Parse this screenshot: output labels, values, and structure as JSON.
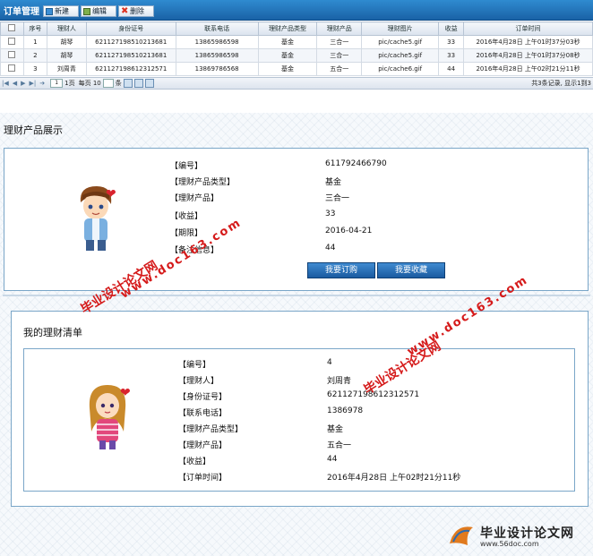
{
  "header": {
    "title": "订单管理",
    "toolbar": {
      "new_label": "新建",
      "edit_label": "编辑",
      "delete_label": "删除"
    }
  },
  "grid": {
    "columns": [
      "",
      "序号",
      "理财人",
      "身份证号",
      "联系电话",
      "理财产品类型",
      "理财产品",
      "理财图片",
      "收益",
      "订单时间"
    ],
    "rows": [
      {
        "no": "1",
        "person": "胡琴",
        "idcard": "621127198510213681",
        "phone": "13865986598",
        "type": "基金",
        "product": "三合一",
        "image": "pic/cache5.gif",
        "income": "33",
        "time": "2016年4月28日 上午01时37分03秒"
      },
      {
        "no": "2",
        "person": "胡琴",
        "idcard": "621127198510213681",
        "phone": "13865986598",
        "type": "基金",
        "product": "三合一",
        "image": "pic/cache5.gif",
        "income": "33",
        "time": "2016年4月28日 上午01时37分08秒"
      },
      {
        "no": "3",
        "person": "刘周青",
        "idcard": "621127198612312571",
        "phone": "13869786568",
        "type": "基金",
        "product": "五合一",
        "image": "pic/cache6.gif",
        "income": "44",
        "time": "2016年4月28日 上午02时21分11秒"
      }
    ]
  },
  "pager": {
    "page_value": "1",
    "page_suffix": "1页",
    "per_page_label": "每页 10",
    "per_page_unit": "条",
    "summary": "共3条记录, 显示1到3"
  },
  "product_display": {
    "title": "理财产品展示",
    "fields": [
      {
        "label": "【编号】",
        "value": "611792466790"
      },
      {
        "label": "【理财产品类型】",
        "value": "基金"
      },
      {
        "label": "【理财产品】",
        "value": "三合一"
      },
      {
        "label": "【收益】",
        "value": "33"
      },
      {
        "label": "【期限】",
        "value": "2016-04-21"
      },
      {
        "label": "【备注信息】",
        "value": "44"
      }
    ],
    "buy_button": "我要订购",
    "fav_button": "我要收藏"
  },
  "my_list": {
    "title": "我的理财清单",
    "fields": [
      {
        "label": "【编号】",
        "value": "4"
      },
      {
        "label": "【理财人】",
        "value": "刘周青"
      },
      {
        "label": "【身份证号】",
        "value": "621127198612312571"
      },
      {
        "label": "【联系电话】",
        "value": "1386978"
      },
      {
        "label": "【理财产品类型】",
        "value": "基金"
      },
      {
        "label": "【理财产品】",
        "value": "五合一"
      },
      {
        "label": "【收益】",
        "value": "44"
      },
      {
        "label": "【订单时间】",
        "value": "2016年4月28日 上午02时21分11秒"
      }
    ]
  },
  "watermark": {
    "text_cn": "毕业设计论文网",
    "text_url": "www.doc163.com",
    "logo_cn": "毕业设计论文网",
    "logo_url": "www.56doc.com"
  },
  "colors": {
    "header_blue": "#1a62a6",
    "button_blue": "#1a5aa0",
    "watermark_red": "#d51a1a"
  }
}
